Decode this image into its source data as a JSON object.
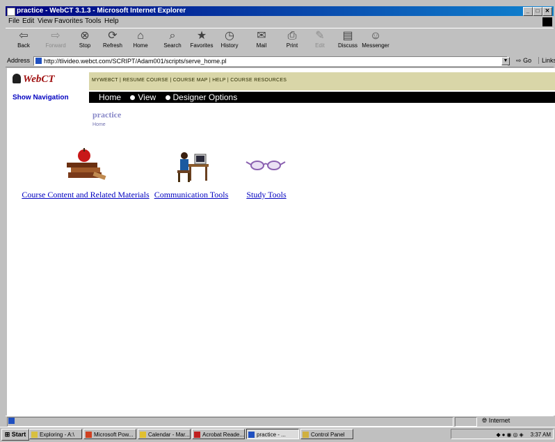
{
  "window": {
    "title": "practice - WebCT 3.1.3 - Microsoft Internet Explorer"
  },
  "menu": [
    "File",
    "Edit",
    "View",
    "Favorites",
    "Tools",
    "Help"
  ],
  "toolbar": [
    {
      "label": "Back",
      "icon": "back-arrow-icon",
      "glyph": "⇦",
      "enabled": true
    },
    {
      "label": "Forward",
      "icon": "forward-arrow-icon",
      "glyph": "⇨",
      "enabled": false
    },
    {
      "label": "Stop",
      "icon": "stop-icon",
      "glyph": "⊗",
      "enabled": true
    },
    {
      "label": "Refresh",
      "icon": "refresh-icon",
      "glyph": "⟳",
      "enabled": true
    },
    {
      "label": "Home",
      "icon": "home-icon",
      "glyph": "⌂",
      "enabled": true
    },
    {
      "label": "Search",
      "icon": "search-icon",
      "glyph": "⌕",
      "enabled": true
    },
    {
      "label": "Favorites",
      "icon": "favorites-icon",
      "glyph": "★",
      "enabled": true
    },
    {
      "label": "History",
      "icon": "history-icon",
      "glyph": "◷",
      "enabled": true
    },
    {
      "label": "Mail",
      "icon": "mail-icon",
      "glyph": "✉",
      "enabled": true
    },
    {
      "label": "Print",
      "icon": "print-icon",
      "glyph": "⎙",
      "enabled": true
    },
    {
      "label": "Edit",
      "icon": "edit-icon",
      "glyph": "✎",
      "enabled": false
    },
    {
      "label": "Discuss",
      "icon": "discuss-icon",
      "glyph": "▤",
      "enabled": true
    },
    {
      "label": "Messenger",
      "icon": "messenger-icon",
      "glyph": "☺",
      "enabled": true
    }
  ],
  "address": {
    "label": "Address",
    "url": "http://tlivideo.webct.com/SCRIPT/Adam001/scripts/serve_home.pl",
    "go": "Go",
    "links": "Links"
  },
  "webct": {
    "logo": "WebCT",
    "show_navigation": "Show Navigation",
    "top_links": "MYWEBCT | RESUME COURSE | COURSE MAP | HELP | COURSE RESOURCES",
    "modes": {
      "home": "Home",
      "view": "View",
      "designer": "Designer Options"
    },
    "page_title": "practice",
    "breadcrumb": "Home",
    "tools": [
      {
        "label": "Course Content and Related Materials",
        "icon": "books-apple-icon"
      },
      {
        "label": "Communication Tools",
        "icon": "person-at-computer-icon"
      },
      {
        "label": "Study Tools",
        "icon": "glasses-icon"
      }
    ]
  },
  "status": {
    "zone": "Internet"
  },
  "taskbar": {
    "start": "Start",
    "tasks": [
      "Exploring - A:\\",
      "Microsoft Pow...",
      "Calendar - Mar...",
      "Acrobat Reade...",
      "practice - ...",
      "Control Panel"
    ],
    "clock": "3:37 AM"
  },
  "colors": {
    "title_bar": "#000080",
    "nav_band": "#d9d6a8",
    "link": "#0000c0",
    "chrome": "#c0c0c0"
  }
}
